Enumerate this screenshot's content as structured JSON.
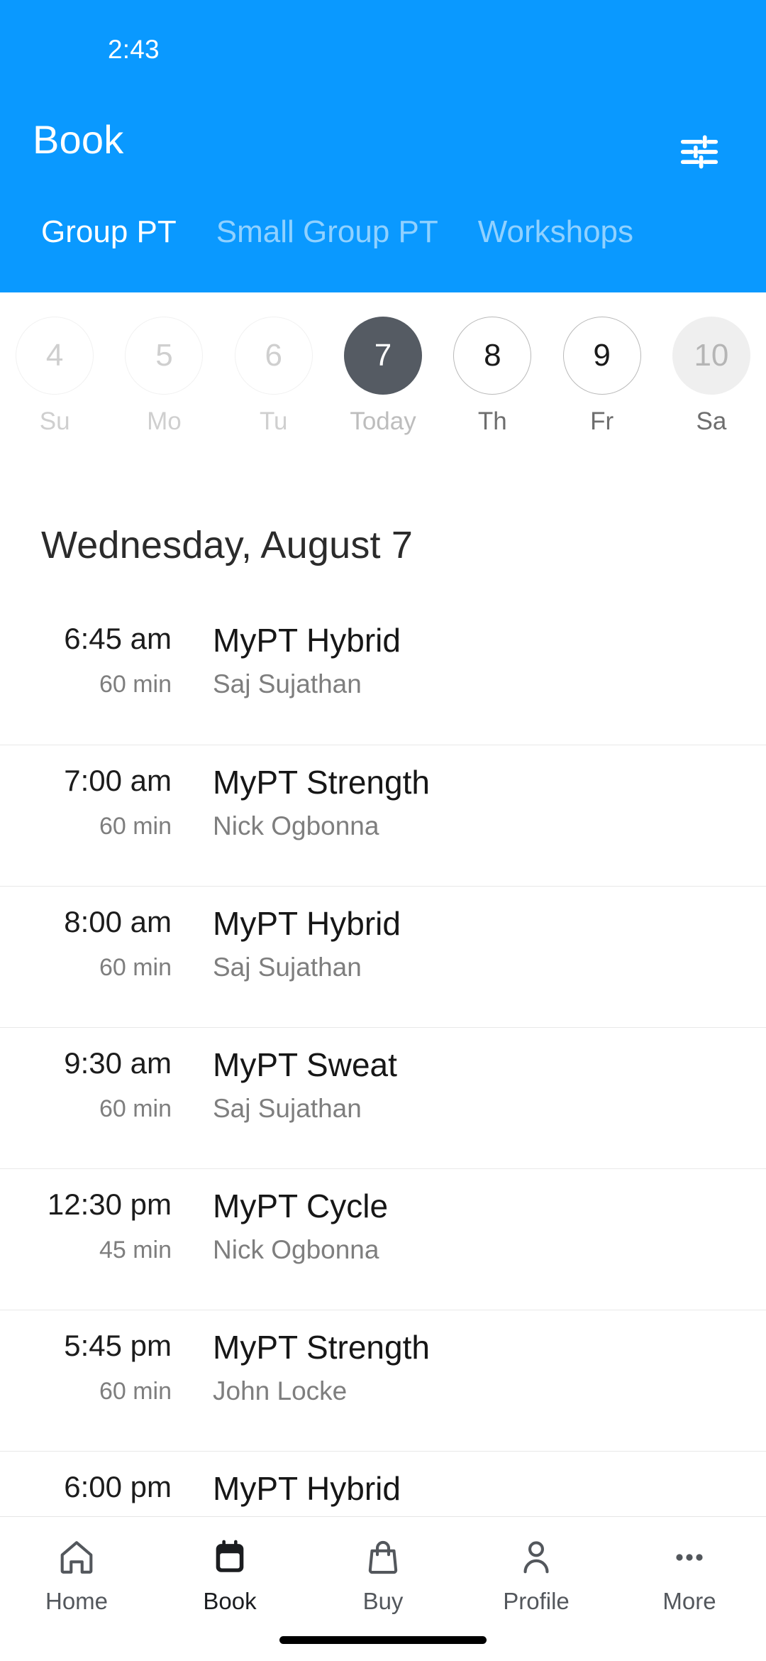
{
  "status_bar": {
    "time": "2:43"
  },
  "app_bar": {
    "title": "Book",
    "filter_icon": "tune-sliders-icon",
    "background_color": "#0A99FF"
  },
  "tabs": [
    {
      "label": "Group PT",
      "active": true
    },
    {
      "label": "Small Group PT",
      "active": false
    },
    {
      "label": "Workshops",
      "active": false
    }
  ],
  "date_strip": [
    {
      "day": "4",
      "weekday": "Su",
      "state": "past"
    },
    {
      "day": "5",
      "weekday": "Mo",
      "state": "past"
    },
    {
      "day": "6",
      "weekday": "Tu",
      "state": "past"
    },
    {
      "day": "7",
      "weekday": "Today",
      "state": "selected"
    },
    {
      "day": "8",
      "weekday": "Th",
      "state": "available"
    },
    {
      "day": "9",
      "weekday": "Fr",
      "state": "available"
    },
    {
      "day": "10",
      "weekday": "Sa",
      "state": "muted"
    }
  ],
  "selected_day_heading": "Wednesday, August 7",
  "classes": [
    {
      "time": "6:45 am",
      "duration": "60 min",
      "name": "MyPT Hybrid",
      "instructor": "Saj Sujathan"
    },
    {
      "time": "7:00 am",
      "duration": "60 min",
      "name": "MyPT Strength",
      "instructor": "Nick Ogbonna"
    },
    {
      "time": "8:00 am",
      "duration": "60 min",
      "name": "MyPT Hybrid",
      "instructor": "Saj Sujathan"
    },
    {
      "time": "9:30 am",
      "duration": "60 min",
      "name": "MyPT Sweat",
      "instructor": "Saj Sujathan"
    },
    {
      "time": "12:30 pm",
      "duration": "45 min",
      "name": "MyPT Cycle",
      "instructor": "Nick Ogbonna"
    },
    {
      "time": "5:45 pm",
      "duration": "60 min",
      "name": "MyPT Strength",
      "instructor": "John Locke"
    },
    {
      "time": "6:00 pm",
      "duration": "",
      "name": "MyPT Hybrid",
      "instructor": ""
    }
  ],
  "bottom_nav": [
    {
      "label": "Home",
      "icon": "home-icon",
      "active": false
    },
    {
      "label": "Book",
      "icon": "calendar-icon",
      "active": true
    },
    {
      "label": "Buy",
      "icon": "bag-icon",
      "active": false
    },
    {
      "label": "Profile",
      "icon": "person-icon",
      "active": false
    },
    {
      "label": "More",
      "icon": "ellipsis-icon",
      "active": false
    }
  ],
  "colors": {
    "brand_blue": "#0A99FF",
    "selected_date": "#555B63",
    "muted_date": "#EFEFEF",
    "divider": "#E8E8E8"
  }
}
